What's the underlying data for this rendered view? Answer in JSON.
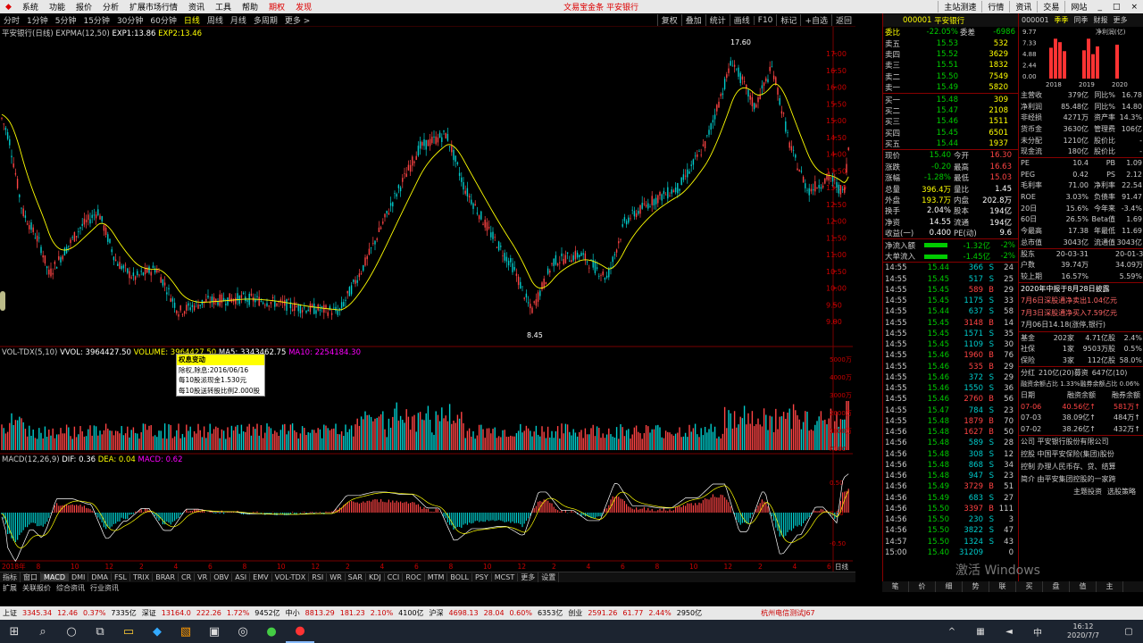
{
  "menu": {
    "items": [
      "系统",
      "功能",
      "报价",
      "分析",
      "扩展市场行情",
      "资讯",
      "工具",
      "帮助",
      "期权",
      "发现"
    ],
    "ticker": "文易宝金条 平安银行",
    "right": [
      "主站测速",
      "行情",
      "资讯",
      "交易",
      "网站"
    ],
    "window_controls": [
      "_",
      "□",
      "×"
    ]
  },
  "period": {
    "items": [
      "分时",
      "1分钟",
      "5分钟",
      "15分钟",
      "30分钟",
      "60分钟",
      "日线",
      "周线",
      "月线",
      "多周期",
      "更多 >"
    ],
    "selected": "日线",
    "tools": [
      "复权",
      "叠加",
      "统计",
      "画线",
      "F10",
      "标记",
      "+自选",
      "返回"
    ]
  },
  "main_title": {
    "name": "平安银行(日线)",
    "ind": "EXPMA(12,50)",
    "exp1": "EXP1:13.86",
    "exp2": "EXP2:13.46"
  },
  "price_axis": [
    "17.00",
    "16.50",
    "16.00",
    "15.50",
    "15.00",
    "14.50",
    "14.00",
    "13.50",
    "13.00",
    "12.50",
    "12.00",
    "11.50",
    "11.00",
    "10.50",
    "10.00",
    "9.50",
    "9.00"
  ],
  "price_high": "17.60",
  "price_low": "8.45",
  "vol_title": {
    "ind": "VOL-TDX(5,10)",
    "vvol": "VVOL: 3964427.50",
    "volume": "VOLUME: 3964427.50",
    "ma5": "MA5: 3343462.75",
    "ma10": "MA10: 2254184.30"
  },
  "vol_axis": [
    "5000万",
    "4000万",
    "3000万",
    "2000万",
    "1000万",
    "X100"
  ],
  "macd_title": {
    "ind": "MACD(12,26,9)",
    "dif": "DIF: 0.36",
    "dea": "DEA: 0.04",
    "macd": "MACD: 0.62"
  },
  "macd_axis": [
    "0.50",
    "0.00",
    "-0.50"
  ],
  "x_axis": [
    "2018年",
    "8",
    "10",
    "12",
    "2",
    "4",
    "6",
    "8",
    "10",
    "12",
    "2",
    "4",
    "6",
    "8",
    "10",
    "12",
    "2",
    "4",
    "6",
    "8",
    "10",
    "12",
    "2",
    "4",
    "6"
  ],
  "x_axis_right": "日线",
  "tooltip": {
    "title": "权息变动",
    "lines": [
      "除权,除息:2016/06/16",
      "每10股派现金1.530元",
      "每10股送转股比例2.000股"
    ]
  },
  "ind_tabs": [
    "指标",
    "窗口",
    "MACD",
    "DMI",
    "DMA",
    "FSL",
    "TRIX",
    "BRAR",
    "CR",
    "VR",
    "OBV",
    "ASI",
    "EMV",
    "VOL-TDX",
    "RSI",
    "WR",
    "SAR",
    "KDJ",
    "CCI",
    "ROC",
    "MTM",
    "BOLL",
    "PSY",
    "MCST",
    "更多",
    "设置"
  ],
  "ind_tab_selected": "MACD",
  "sub_tabs": [
    "扩展",
    "关联报价",
    "综合资讯",
    "行业资讯"
  ],
  "stock": {
    "code": "000001",
    "name": "平安银行"
  },
  "orderbook": {
    "weibi": {
      "label": "委比",
      "value": "-22.05%",
      "label2": "委差",
      "value2": "-6986"
    },
    "sells": [
      [
        "卖五",
        "15.53",
        "532"
      ],
      [
        "卖四",
        "15.52",
        "3629"
      ],
      [
        "卖三",
        "15.51",
        "1832"
      ],
      [
        "卖二",
        "15.50",
        "7549"
      ],
      [
        "卖一",
        "15.49",
        "5820"
      ]
    ],
    "buys": [
      [
        "买一",
        "15.48",
        "309"
      ],
      [
        "买二",
        "15.47",
        "2108"
      ],
      [
        "买三",
        "15.46",
        "1511"
      ],
      [
        "买四",
        "15.45",
        "6501"
      ],
      [
        "买五",
        "15.44",
        "1937"
      ]
    ]
  },
  "quote": [
    [
      "现价",
      "15.40",
      "今开",
      "16.30"
    ],
    [
      "涨跌",
      "-0.20",
      "最高",
      "16.63"
    ],
    [
      "涨幅",
      "-1.28%",
      "最低",
      "15.03"
    ],
    [
      "总量",
      "396.4万",
      "量比",
      "1.45"
    ],
    [
      "外盘",
      "193.7万",
      "内盘",
      "202.8万"
    ],
    [
      "换手",
      "2.04%",
      "股本",
      "194亿"
    ],
    [
      "净资",
      "14.55",
      "流通",
      "194亿"
    ],
    [
      "收益(一)",
      "0.400",
      "PE(动)",
      "9.6"
    ]
  ],
  "flow": [
    [
      "净流入额",
      "-1.32亿",
      "-2%"
    ],
    [
      "大单流入",
      "-1.45亿",
      "-2%"
    ]
  ],
  "ticks": [
    [
      "14:55",
      "15.44",
      "366",
      "S",
      "24"
    ],
    [
      "14:55",
      "15.45",
      "517",
      "S",
      "25"
    ],
    [
      "14:55",
      "15.45",
      "589",
      "B",
      "29"
    ],
    [
      "14:55",
      "15.45",
      "1175",
      "S",
      "33"
    ],
    [
      "14:55",
      "15.44",
      "637",
      "S",
      "58"
    ],
    [
      "14:55",
      "15.45",
      "3148",
      "B",
      "14"
    ],
    [
      "14:55",
      "15.45",
      "1571",
      "S",
      "35"
    ],
    [
      "14:55",
      "15.45",
      "1109",
      "S",
      "30"
    ],
    [
      "14:55",
      "15.46",
      "1960",
      "B",
      "76"
    ],
    [
      "14:55",
      "15.46",
      "535",
      "B",
      "29"
    ],
    [
      "14:55",
      "15.46",
      "372",
      "S",
      "29"
    ],
    [
      "14:55",
      "15.46",
      "1550",
      "S",
      "36"
    ],
    [
      "14:55",
      "15.46",
      "2760",
      "B",
      "56"
    ],
    [
      "14:55",
      "15.47",
      "784",
      "S",
      "23"
    ],
    [
      "14:55",
      "15.48",
      "1879",
      "B",
      "70"
    ],
    [
      "14:56",
      "15.48",
      "1627",
      "B",
      "50"
    ],
    [
      "14:56",
      "15.48",
      "589",
      "S",
      "28"
    ],
    [
      "14:56",
      "15.48",
      "308",
      "S",
      "12"
    ],
    [
      "14:56",
      "15.48",
      "868",
      "S",
      "34"
    ],
    [
      "14:56",
      "15.48",
      "947",
      "S",
      "23"
    ],
    [
      "14:56",
      "15.49",
      "3729",
      "B",
      "51"
    ],
    [
      "14:56",
      "15.49",
      "683",
      "S",
      "27"
    ],
    [
      "14:56",
      "15.50",
      "3397",
      "B",
      "111"
    ],
    [
      "14:56",
      "15.50",
      "230",
      "S",
      "3"
    ],
    [
      "14:56",
      "15.50",
      "3822",
      "S",
      "47"
    ],
    [
      "14:57",
      "15.50",
      "1324",
      "S",
      "43"
    ],
    [
      "15:00",
      "15.40",
      "31209",
      "",
      "0"
    ]
  ],
  "fin_tabs": [
    "000001",
    "季季",
    "同季",
    "财报",
    "更多"
  ],
  "fin_chart": {
    "label": "净利润(亿)",
    "years": [
      "2018",
      "2019",
      "2020"
    ],
    "yaxis": [
      "9.77",
      "7.33",
      "4.88",
      "2.44",
      "0.00"
    ]
  },
  "fin": [
    [
      "主营收",
      "379亿",
      "同比%",
      "16.78"
    ],
    [
      "净利润",
      "85.48亿",
      "同比%",
      "14.80"
    ],
    [
      "非经损",
      "4271万",
      "资产率",
      "14.3%"
    ],
    [
      "货币金",
      "3630亿",
      "管理费",
      "106亿"
    ],
    [
      "未分配",
      "1210亿",
      "股价比",
      "-"
    ],
    [
      "现金流",
      "180亿",
      "股价比",
      "-"
    ],
    [
      "PE",
      "10.4",
      "PB",
      "1.09"
    ],
    [
      "PEG",
      "0.42",
      "PS",
      "2.12"
    ],
    [
      "毛利率",
      "71.00",
      "净利率",
      "22.54"
    ],
    [
      "ROE",
      "3.03%",
      "负债率",
      "91.47"
    ],
    [
      "20日",
      "15.6%",
      "今年来",
      "-3.4%"
    ],
    [
      "60日",
      "26.5%",
      "Beta值",
      "1.69"
    ],
    [
      "今最高",
      "17.38",
      "年最低",
      "11.69"
    ],
    [
      "总市值",
      "3043亿",
      "流通值",
      "3043亿"
    ],
    [
      "股东",
      "20-03-31",
      "",
      "20-01-31"
    ],
    [
      "户数",
      "39.74万",
      "",
      "34.09万"
    ],
    [
      "较上期",
      "16.57%",
      "",
      "5.59%"
    ]
  ],
  "news": [
    "2020年中报于8月28日披露",
    "7月6日深股通净卖出1.04亿元",
    "7月3日深股通净买入7.59亿元",
    "7月06日14.18(涨停,银行)"
  ],
  "fund": [
    [
      "基金",
      "202家",
      "4.71亿股",
      "2.4%"
    ],
    [
      "社保",
      "1家",
      "9503万股",
      "0.5%"
    ],
    [
      "保险",
      "3家",
      "112亿股",
      "58.0%"
    ]
  ],
  "margin_head": [
    "分红",
    "210亿(20)募资",
    "647亿(10)"
  ],
  "margin_ratio": "融资余额占比 1.33%融券余额占比 0.06%",
  "margin_cols": [
    "日期",
    "融资余额",
    "融券余额"
  ],
  "margin": [
    [
      "07-06",
      "40.56亿↑",
      "581万↑"
    ],
    [
      "07-03",
      "38.09亿↑",
      "484万↑"
    ],
    [
      "07-02",
      "38.26亿↑",
      "432万↑"
    ]
  ],
  "company": [
    "公司 平安银行股份有限公司",
    "控股 中国平安保险(集团)股份",
    "控制 办理人民币存、贷、结算",
    "简介 由平安集团控股的一家跨"
  ],
  "side_bottom_links": [
    "主题投资",
    "选股策略"
  ],
  "watermark": "激活 Windows",
  "bottom_tabs": [
    "笔",
    "价",
    "细",
    "势",
    "联",
    "买",
    "盘",
    "值",
    "主"
  ],
  "statusbar": [
    "上证",
    "3345.34",
    "12.46",
    "0.37%",
    "7335亿",
    "深证",
    "13164.0",
    "222.26",
    "1.72%",
    "9452亿",
    "中小",
    "8813.29",
    "181.23",
    "2.10%",
    "4100亿",
    "沪深",
    "4698.13",
    "28.04",
    "0.60%",
    "6353亿",
    "创业",
    "2591.26",
    "61.77",
    "2.44%",
    "2950亿",
    "杭州电信测试J67"
  ],
  "clock": {
    "time": "16:12",
    "date": "2020/7/7"
  },
  "tray": [
    "中"
  ],
  "colors": {
    "up": "#ff4444",
    "down": "#00cccc",
    "ma": "#ffff00",
    "bg": "#000000"
  }
}
